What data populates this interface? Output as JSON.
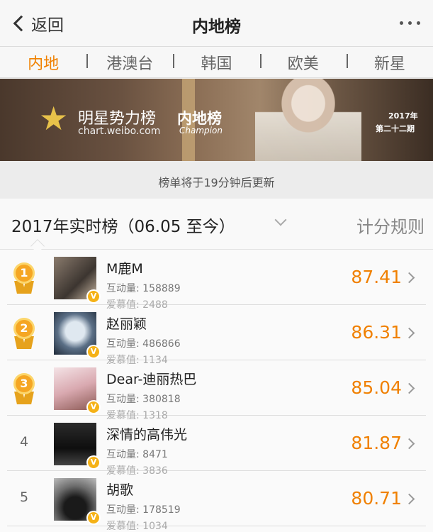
{
  "nav": {
    "back_label": "返回",
    "title": "内地榜",
    "more_icon": "more-icon"
  },
  "tabs": [
    {
      "label": "内地",
      "active": true
    },
    {
      "label": "港澳台",
      "active": false
    },
    {
      "label": "韩国",
      "active": false
    },
    {
      "label": "欧美",
      "active": false
    },
    {
      "label": "新星",
      "active": false
    }
  ],
  "banner": {
    "brand": "明星势力榜",
    "site": "chart.weibo.com",
    "region": "内地榜",
    "champion": "Champion",
    "year": "2017年",
    "period": "第二十二期"
  },
  "update_notice": "榜单将于19分钟后更新",
  "list_header": {
    "period_label": "2017年实时榜（06.05 至今）",
    "rules_label": "计分规则"
  },
  "colors": {
    "accent": "#f08000",
    "medal": "#f5a623",
    "verified": "#f5b217"
  },
  "rows": [
    {
      "rank": "1",
      "name": "M鹿M",
      "interaction": "互动量: 158889",
      "love": "爱慕值: 2488",
      "score": "87.41"
    },
    {
      "rank": "2",
      "name": "赵丽颖",
      "interaction": "互动量: 486866",
      "love": "爱慕值: 1134",
      "score": "86.31"
    },
    {
      "rank": "3",
      "name": "Dear-迪丽热巴",
      "interaction": "互动量: 380818",
      "love": "爱慕值: 1318",
      "score": "85.04"
    },
    {
      "rank": "4",
      "name": "深情的高伟光",
      "interaction": "互动量: 8471",
      "love": "爱慕值: 3836",
      "score": "81.87"
    },
    {
      "rank": "5",
      "name": "胡歌",
      "interaction": "互动量: 178519",
      "love": "爱慕值: 1034",
      "score": "80.71"
    }
  ]
}
